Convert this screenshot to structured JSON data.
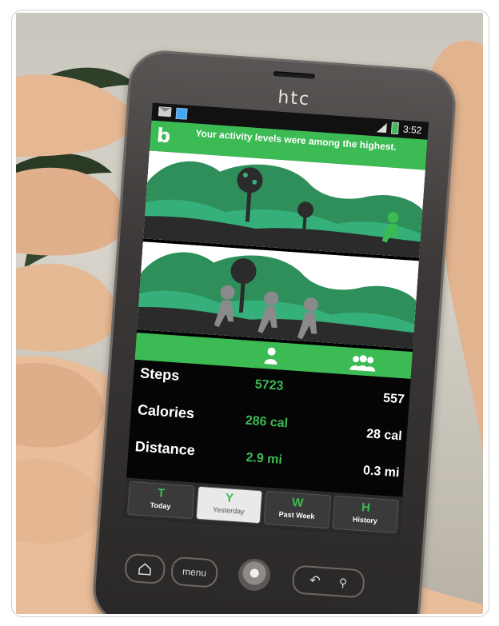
{
  "phone": {
    "brand": "htc",
    "status_time": "3:52"
  },
  "app": {
    "logo": "b",
    "notification": "Your activity levels were among the highest."
  },
  "stats": {
    "rows": [
      {
        "label": "Steps",
        "mine": "5723",
        "avg": "557"
      },
      {
        "label": "Calories",
        "mine": "286 cal",
        "avg": "28 cal"
      },
      {
        "label": "Distance",
        "mine": "2.9 mi",
        "avg": "0.3 mi"
      }
    ]
  },
  "tabs": [
    {
      "letter": "T",
      "name": "Today",
      "active": false
    },
    {
      "letter": "Y",
      "name": "Yesterday",
      "active": true
    },
    {
      "letter": "W",
      "name": "Past Week",
      "active": false
    },
    {
      "letter": "H",
      "name": "History",
      "active": false
    }
  ],
  "keys": {
    "menu": "menu"
  },
  "colors": {
    "accent_green": "#3cba54",
    "scene_green_dark": "#2f8f5b",
    "scene_green_light": "#35b07a",
    "ground": "#2b2b2b",
    "figures": "#8a8a8a"
  }
}
